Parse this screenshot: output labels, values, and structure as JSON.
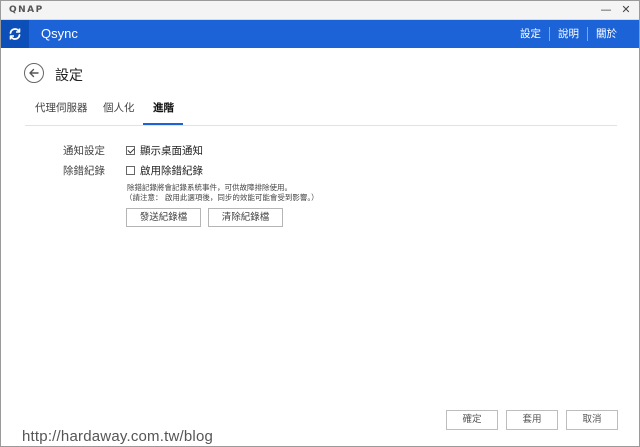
{
  "titlebar": {
    "brand": "QNAP",
    "minimize": "—",
    "close": "✕"
  },
  "header": {
    "app_name": "Qsync",
    "links": [
      "設定",
      "說明",
      "關於"
    ]
  },
  "page": {
    "title": "設定"
  },
  "tabs": [
    {
      "label": "代理伺服器",
      "active": false
    },
    {
      "label": "個人化",
      "active": false
    },
    {
      "label": "進階",
      "active": true
    }
  ],
  "settings": {
    "notify": {
      "label": "通知設定",
      "option": "顯示桌面通知",
      "checked": true
    },
    "debug": {
      "label": "除錯紀錄",
      "option": "啟用除錯紀錄",
      "checked": false,
      "desc_line1": "除錯記錄將會記錄系統事件，可供故障排除使用。",
      "desc_line2": "（請注意： 啟用此選項後，同步的效能可能會受到影響。）",
      "send_button": "發送紀錄檔",
      "clear_button": "清除紀錄檔"
    }
  },
  "footer": {
    "ok": "確定",
    "apply": "套用",
    "cancel": "取消"
  },
  "watermark": "http://hardaway.com.tw/blog",
  "colors": {
    "header_blue": "#1d63d8",
    "icon_box_blue": "#0d4fb8"
  }
}
